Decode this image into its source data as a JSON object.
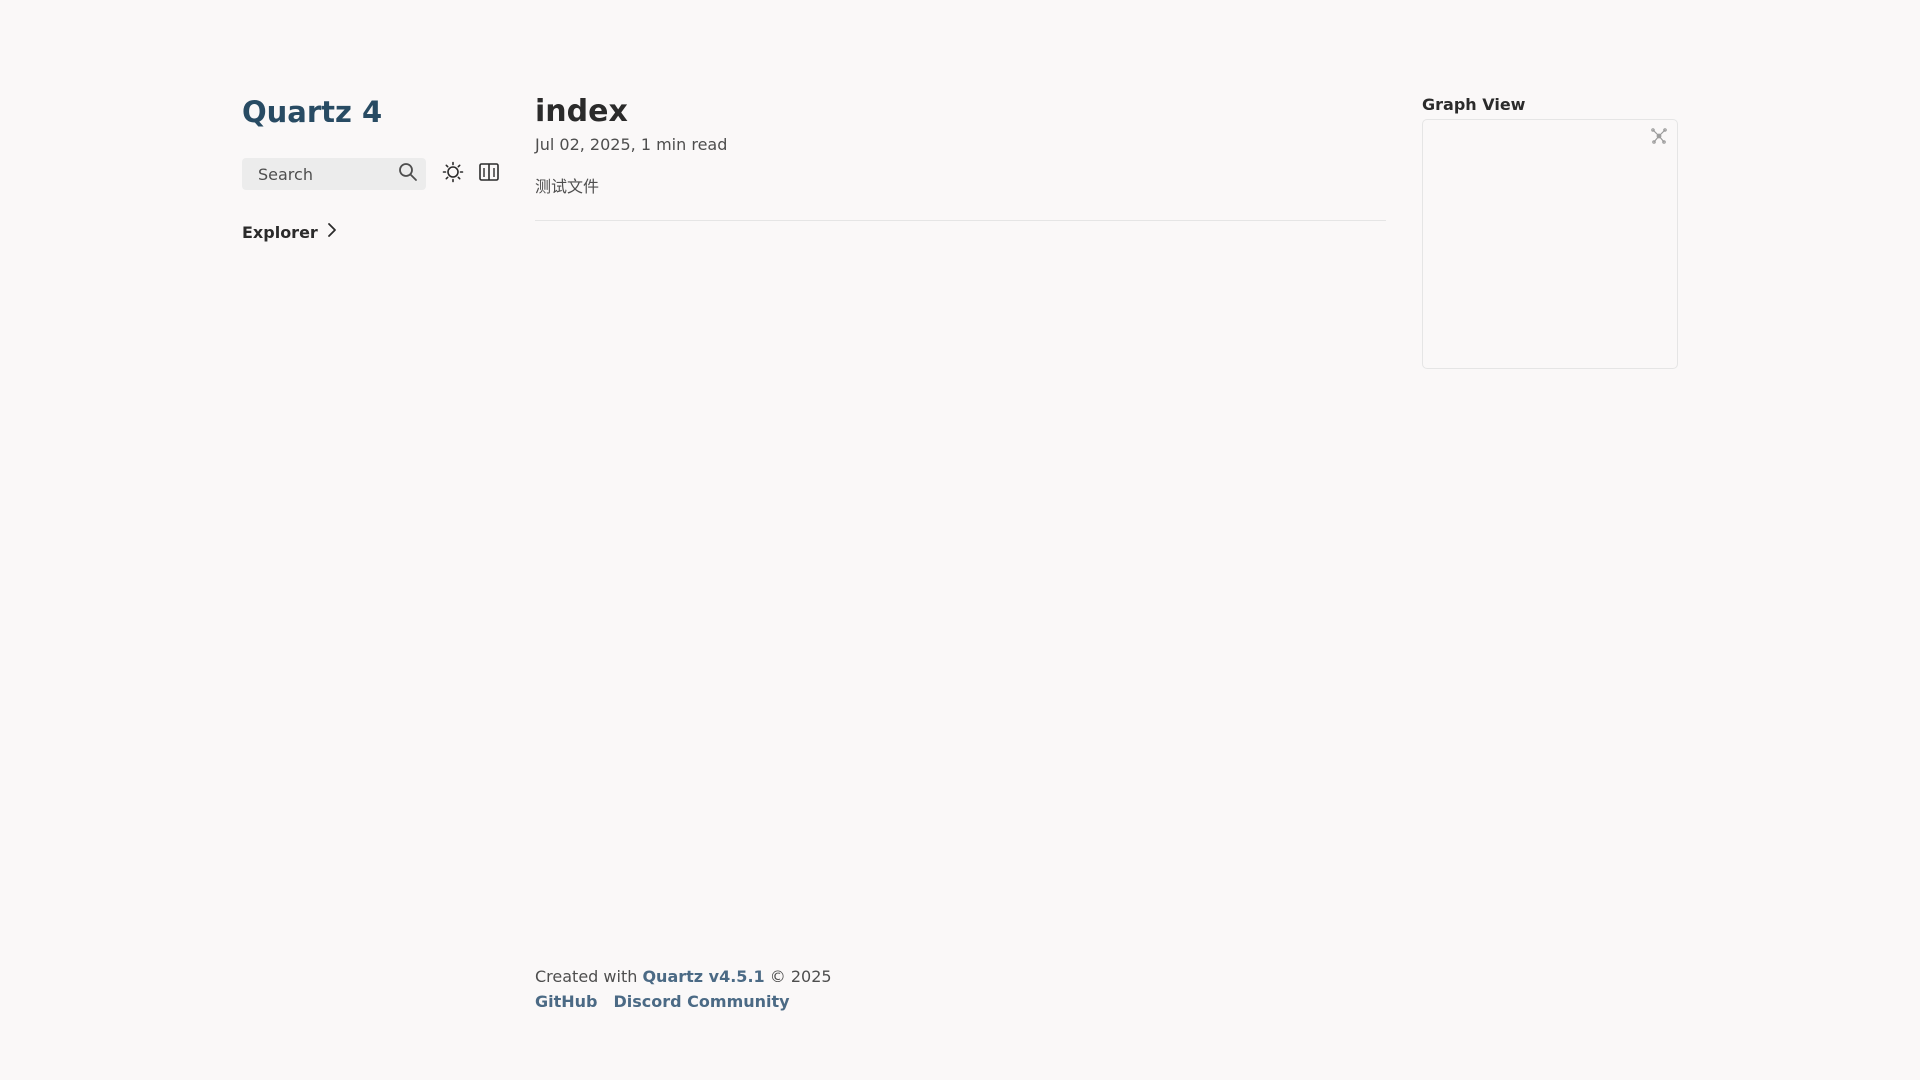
{
  "site": {
    "title": "Quartz 4"
  },
  "search": {
    "placeholder": "Search"
  },
  "explorer": {
    "label": "Explorer"
  },
  "article": {
    "title": "index",
    "date": "Jul 02, 2025",
    "read_time": "1 min read",
    "content": "测试文件"
  },
  "graph": {
    "title": "Graph View"
  },
  "footer": {
    "created_prefix": "Created with",
    "quartz_link": "Quartz v4.5.1",
    "copyright": "© 2025",
    "links": [
      "GitHub",
      "Discord Community"
    ]
  },
  "icons": {
    "search": "search-icon",
    "theme": "sun-icon",
    "reader": "book-icon",
    "explorer_toggle": "chevron-right-icon",
    "graph_global": "global-graph-icon"
  },
  "colors": {
    "accent": "#284b63",
    "link": "#4b6a85",
    "background": "#faf8f8",
    "text": "#2b2b2b"
  }
}
